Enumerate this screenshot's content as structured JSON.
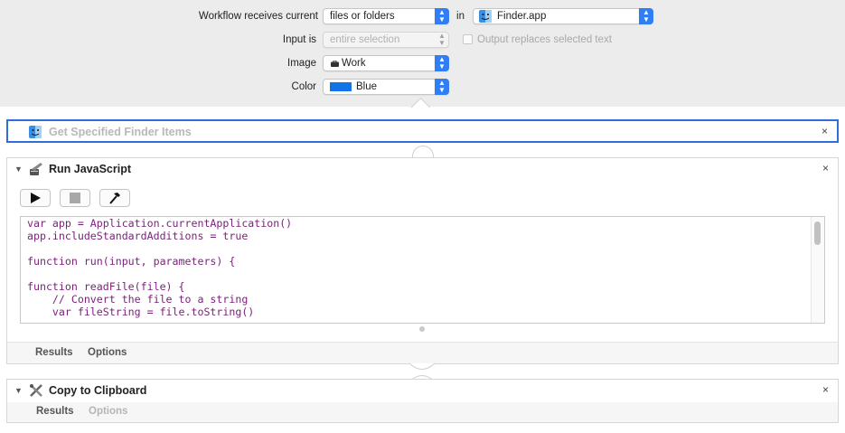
{
  "header": {
    "receives_label": "Workflow receives current",
    "receives_value": "files or folders",
    "in_label": "in",
    "app_value": "Finder.app",
    "input_label": "Input is",
    "input_value": "entire selection",
    "replace_label": "Output replaces selected text",
    "image_label": "Image",
    "image_value": "Work",
    "color_label": "Color",
    "color_value": "Blue",
    "color_swatch": "#1273e6"
  },
  "actions": {
    "finder": {
      "title": "Get Specified Finder Items"
    },
    "js": {
      "title": "Run JavaScript",
      "code": "var app = Application.currentApplication()\napp.includeStandardAdditions = true\n\nfunction run(input, parameters) {\n\nfunction readFile(file) {\n    // Convert the file to a string\n    var fileString = file.toString()",
      "results": "Results",
      "options": "Options"
    },
    "clipboard": {
      "title": "Copy to Clipboard",
      "results": "Results",
      "options": "Options"
    }
  },
  "symbols": {
    "close": "×",
    "disclose": "▼",
    "arrows": "▲▼"
  }
}
